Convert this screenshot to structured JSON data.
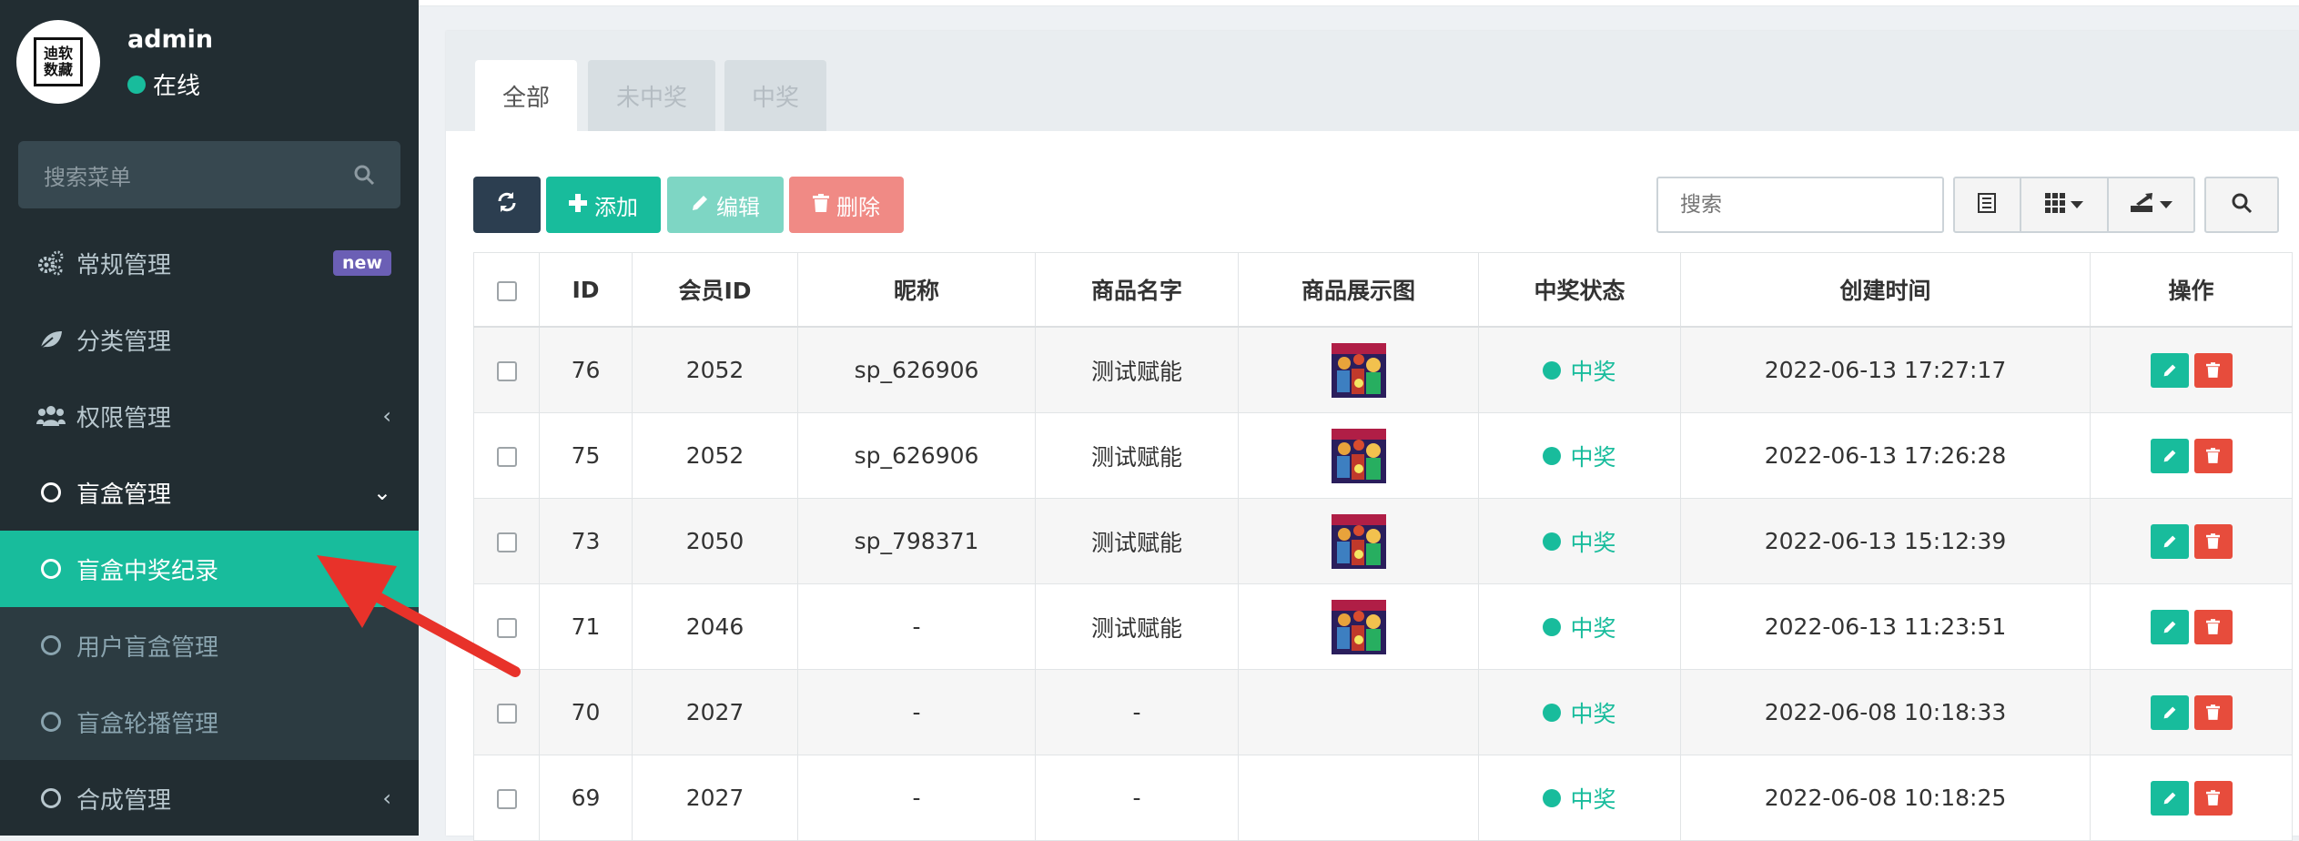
{
  "user": {
    "avatar_line1": "迪软",
    "avatar_line2": "数藏",
    "name": "admin",
    "status": "在线"
  },
  "sidebar": {
    "search_placeholder": "搜索菜单",
    "items": [
      {
        "label": "常规管理",
        "badge": "new"
      },
      {
        "label": "分类管理"
      },
      {
        "label": "权限管理",
        "chevron": "‹"
      },
      {
        "label": "盲盒管理",
        "chevron": "⌄"
      },
      {
        "label": "盲盒中奖纪录"
      },
      {
        "label": "用户盲盒管理"
      },
      {
        "label": "盲盒轮播管理"
      },
      {
        "label": "合成管理",
        "chevron": "‹"
      }
    ]
  },
  "tabs": [
    "全部",
    "未中奖",
    "中奖"
  ],
  "toolbar": {
    "add": "添加",
    "edit": "编辑",
    "delete": "删除",
    "search_placeholder": "搜索"
  },
  "table": {
    "columns": [
      "ID",
      "会员ID",
      "昵称",
      "商品名字",
      "商品展示图",
      "中奖状态",
      "创建时间",
      "操作"
    ],
    "rows": [
      {
        "id": "76",
        "member_id": "2052",
        "nickname": "sp_626906",
        "product": "测试赋能",
        "has_image": true,
        "status": "中奖",
        "created": "2022-06-13 17:27:17"
      },
      {
        "id": "75",
        "member_id": "2052",
        "nickname": "sp_626906",
        "product": "测试赋能",
        "has_image": true,
        "status": "中奖",
        "created": "2022-06-13 17:26:28"
      },
      {
        "id": "73",
        "member_id": "2050",
        "nickname": "sp_798371",
        "product": "测试赋能",
        "has_image": true,
        "status": "中奖",
        "created": "2022-06-13 15:12:39"
      },
      {
        "id": "71",
        "member_id": "2046",
        "nickname": "-",
        "product": "测试赋能",
        "has_image": true,
        "status": "中奖",
        "created": "2022-06-13 11:23:51"
      },
      {
        "id": "70",
        "member_id": "2027",
        "nickname": "-",
        "product": "-",
        "has_image": false,
        "status": "中奖",
        "created": "2022-06-08 10:18:33"
      },
      {
        "id": "69",
        "member_id": "2027",
        "nickname": "-",
        "product": "-",
        "has_image": false,
        "status": "中奖",
        "created": "2022-06-08 10:18:25"
      }
    ]
  },
  "colors": {
    "sidebar_bg": "#222d32",
    "accent": "#18bc9c",
    "danger": "#e74c3c",
    "dark_button": "#2c3e50",
    "annotation_arrow": "#e8322a"
  }
}
